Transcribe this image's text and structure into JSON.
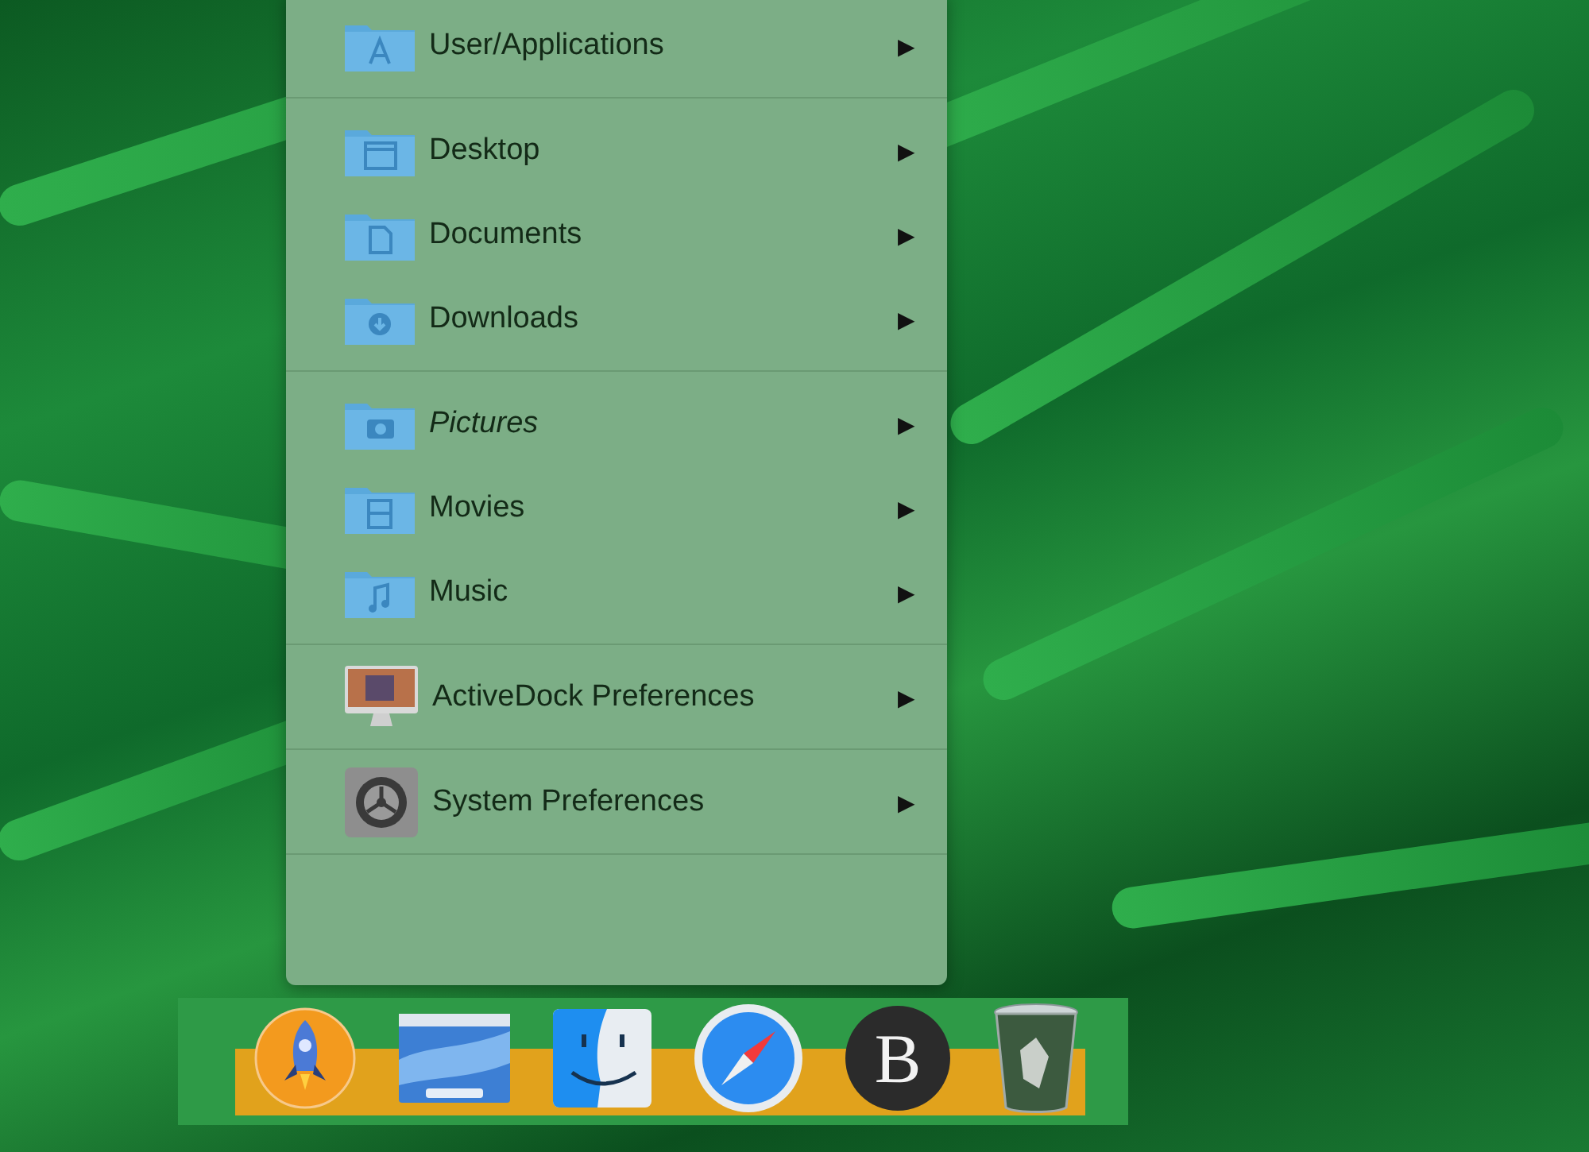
{
  "menu": {
    "groups": [
      [
        {
          "label": "User/Applications",
          "kind": "apps",
          "italic": false
        }
      ],
      [
        {
          "label": "Desktop",
          "kind": "desktop",
          "italic": false
        },
        {
          "label": "Documents",
          "kind": "documents",
          "italic": false
        },
        {
          "label": "Downloads",
          "kind": "downloads",
          "italic": false
        }
      ],
      [
        {
          "label": "Pictures",
          "kind": "pictures",
          "italic": true
        },
        {
          "label": "Movies",
          "kind": "movies",
          "italic": false
        },
        {
          "label": "Music",
          "kind": "music",
          "italic": false
        }
      ],
      [
        {
          "label": "ActiveDock Preferences",
          "kind": "monitor",
          "italic": false
        }
      ],
      [
        {
          "label": "System Preferences",
          "kind": "gear",
          "italic": false
        }
      ]
    ],
    "submenu_arrow": "▶"
  },
  "dock": {
    "items": [
      {
        "kind": "rocket"
      },
      {
        "kind": "screen"
      },
      {
        "kind": "finder"
      },
      {
        "kind": "compass"
      },
      {
        "kind": "letter",
        "text": "B"
      },
      {
        "kind": "trash"
      }
    ]
  }
}
